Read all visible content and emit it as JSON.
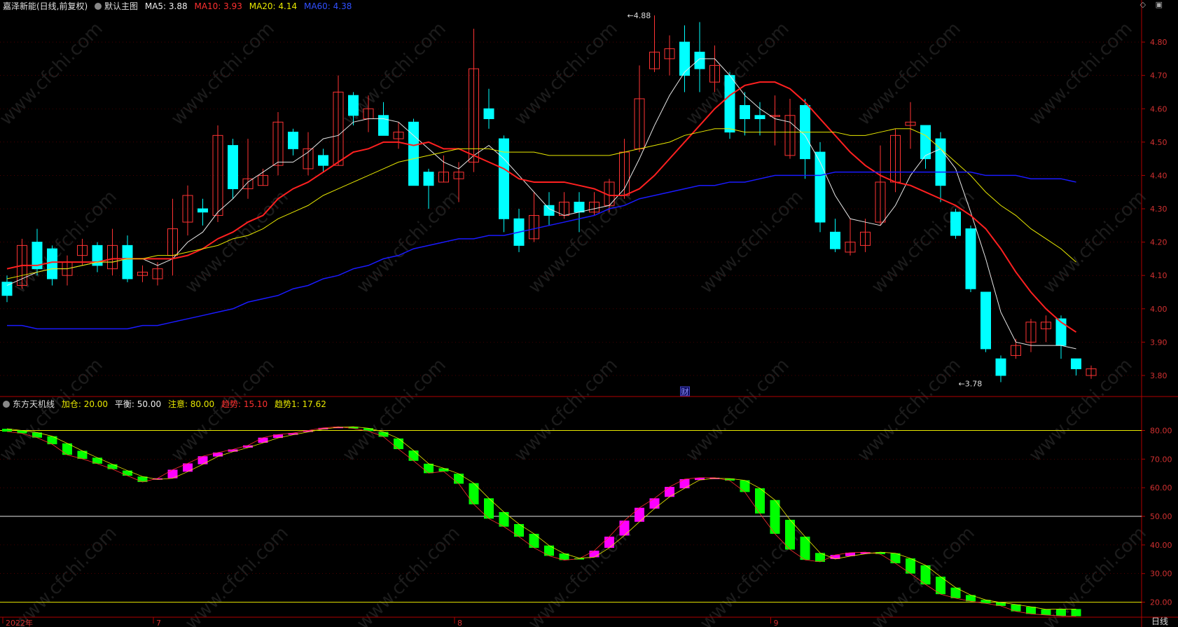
{
  "header": {
    "stock_title": "嘉泽新能(日线,前复权)",
    "main_chart_label": "默认主图",
    "ma5_label": "MA5: 3.88",
    "ma10_label": "MA10: 3.93",
    "ma20_label": "MA20: 4.14",
    "ma60_label": "MA60: 4.38"
  },
  "sub_header": {
    "indicator_name": "东方天机线",
    "jiacang_label": "加仓: 20.00",
    "pingheng_label": "平衡: 50.00",
    "zhuyi_label": "注意: 80.00",
    "qushi_label": "趋势: 15.10",
    "qushi1_label": "趋势1: 17.62"
  },
  "toolbar": {
    "diamond_icon": "diamond-icon",
    "box_icon": "window-icon"
  },
  "footer": {
    "period_label": "日线"
  },
  "colors": {
    "up": "#ff3333",
    "down": "#00ffff",
    "ma5": "#e8e8e8",
    "ma10": "#ff2020",
    "ma20": "#e8e800",
    "ma60": "#1a1aff",
    "sub_up": "#ff00ff",
    "sub_down": "#00ff00",
    "axis": "#b00000",
    "grid": "#7a0000"
  },
  "chart_data": [
    {
      "type": "candlestick",
      "title": "",
      "x_tick_labels": [
        "2022年",
        "7",
        "8",
        "9"
      ],
      "y_tick_labels": [
        "3.80",
        "3.90",
        "4.00",
        "4.10",
        "4.20",
        "4.30",
        "4.40",
        "4.50",
        "4.60",
        "4.70",
        "4.80"
      ],
      "ylim": [
        3.76,
        4.88
      ],
      "annotations": [
        {
          "text": "4.88",
          "value": 4.88,
          "candle_index": 41
        },
        {
          "text": "3.78",
          "value": 3.78,
          "candle_index": 63
        },
        {
          "text": "财",
          "candle_index": 45
        }
      ],
      "candles": [
        [
          4.08,
          4.04,
          4.1,
          4.02
        ],
        [
          4.07,
          4.19,
          4.21,
          4.06
        ],
        [
          4.2,
          4.12,
          4.24,
          4.1
        ],
        [
          4.18,
          4.09,
          4.19,
          4.07
        ],
        [
          4.1,
          4.14,
          4.16,
          4.07
        ],
        [
          4.16,
          4.19,
          4.21,
          4.13
        ],
        [
          4.19,
          4.13,
          4.2,
          4.11
        ],
        [
          4.12,
          4.19,
          4.24,
          4.1
        ],
        [
          4.19,
          4.09,
          4.22,
          4.08
        ],
        [
          4.1,
          4.11,
          4.13,
          4.08
        ],
        [
          4.09,
          4.12,
          4.14,
          4.07
        ],
        [
          4.16,
          4.24,
          4.33,
          4.1
        ],
        [
          4.26,
          4.34,
          4.37,
          4.22
        ],
        [
          4.3,
          4.29,
          4.33,
          4.25
        ],
        [
          4.28,
          4.52,
          4.55,
          4.26
        ],
        [
          4.49,
          4.36,
          4.51,
          4.33
        ],
        [
          4.36,
          4.39,
          4.51,
          4.33
        ],
        [
          4.37,
          4.4,
          4.42,
          4.37
        ],
        [
          4.43,
          4.56,
          4.59,
          4.4
        ],
        [
          4.53,
          4.48,
          4.54,
          4.46
        ],
        [
          4.42,
          4.48,
          4.53,
          4.4
        ],
        [
          4.46,
          4.43,
          4.48,
          4.41
        ],
        [
          4.43,
          4.65,
          4.7,
          4.43
        ],
        [
          4.64,
          4.58,
          4.65,
          4.55
        ],
        [
          4.57,
          4.6,
          4.64,
          4.53
        ],
        [
          4.58,
          4.52,
          4.62,
          4.52
        ],
        [
          4.51,
          4.53,
          4.56,
          4.48
        ],
        [
          4.56,
          4.37,
          4.57,
          4.37
        ],
        [
          4.41,
          4.37,
          4.42,
          4.3
        ],
        [
          4.38,
          4.41,
          4.46,
          4.38
        ],
        [
          4.39,
          4.41,
          4.44,
          4.32
        ],
        [
          4.44,
          4.72,
          4.84,
          4.41
        ],
        [
          4.6,
          4.57,
          4.66,
          4.54
        ],
        [
          4.51,
          4.27,
          4.52,
          4.23
        ],
        [
          4.27,
          4.19,
          4.3,
          4.17
        ],
        [
          4.21,
          4.28,
          4.35,
          4.2
        ],
        [
          4.31,
          4.28,
          4.35,
          4.25
        ],
        [
          4.28,
          4.32,
          4.35,
          4.27
        ],
        [
          4.32,
          4.29,
          4.35,
          4.23
        ],
        [
          4.29,
          4.32,
          4.35,
          4.28
        ],
        [
          4.31,
          4.38,
          4.39,
          4.29
        ],
        [
          4.34,
          4.47,
          4.51,
          4.33
        ],
        [
          4.48,
          4.63,
          4.73,
          4.47
        ],
        [
          4.72,
          4.77,
          4.88,
          4.71
        ],
        [
          4.75,
          4.78,
          4.82,
          4.7
        ],
        [
          4.8,
          4.7,
          4.85,
          4.65
        ],
        [
          4.77,
          4.72,
          4.86,
          4.65
        ],
        [
          4.68,
          4.73,
          4.79,
          4.65
        ],
        [
          4.7,
          4.53,
          4.71,
          4.51
        ],
        [
          4.61,
          4.57,
          4.65,
          4.52
        ],
        [
          4.58,
          4.57,
          4.62,
          4.52
        ],
        [
          4.58,
          4.58,
          4.64,
          4.49
        ],
        [
          4.46,
          4.58,
          4.63,
          4.45
        ],
        [
          4.61,
          4.45,
          4.63,
          4.39
        ],
        [
          4.47,
          4.26,
          4.5,
          4.23
        ],
        [
          4.23,
          4.18,
          4.27,
          4.17
        ],
        [
          4.17,
          4.2,
          4.27,
          4.16
        ],
        [
          4.19,
          4.23,
          4.27,
          4.17
        ],
        [
          4.26,
          4.38,
          4.49,
          4.25
        ],
        [
          4.38,
          4.52,
          4.54,
          4.35
        ],
        [
          4.55,
          4.56,
          4.62,
          4.48
        ],
        [
          4.55,
          4.45,
          4.55,
          4.42
        ],
        [
          4.51,
          4.37,
          4.53,
          4.32
        ],
        [
          4.29,
          4.22,
          4.3,
          4.21
        ],
        [
          4.24,
          4.06,
          4.25,
          4.05
        ],
        [
          4.05,
          3.88,
          4.05,
          3.87
        ],
        [
          3.85,
          3.8,
          3.86,
          3.78
        ],
        [
          3.86,
          3.89,
          3.91,
          3.85
        ],
        [
          3.9,
          3.96,
          3.97,
          3.87
        ],
        [
          3.94,
          3.96,
          3.98,
          3.9
        ],
        [
          3.97,
          3.89,
          3.98,
          3.85
        ],
        [
          3.85,
          3.82,
          3.85,
          3.8
        ],
        [
          3.8,
          3.82,
          3.83,
          3.79
        ]
      ],
      "series": [
        {
          "name": "MA5",
          "values": [
            4.07,
            4.09,
            4.11,
            4.12,
            4.12,
            4.13,
            4.14,
            4.14,
            4.15,
            4.15,
            4.13,
            4.15,
            4.2,
            4.23,
            4.29,
            4.33,
            4.38,
            4.41,
            4.44,
            4.44,
            4.47,
            4.51,
            4.52,
            4.56,
            4.57,
            4.57,
            4.56,
            4.52,
            4.48,
            4.44,
            4.42,
            4.46,
            4.49,
            4.45,
            4.4,
            4.35,
            4.3,
            4.28,
            4.29,
            4.3,
            4.31,
            4.36,
            4.45,
            4.55,
            4.64,
            4.71,
            4.75,
            4.75,
            4.7,
            4.64,
            4.6,
            4.57,
            4.56,
            4.52,
            4.44,
            4.34,
            4.27,
            4.26,
            4.25,
            4.31,
            4.4,
            4.46,
            4.48,
            4.42,
            4.29,
            4.15,
            3.99,
            3.9,
            3.89,
            3.89,
            3.89,
            3.88
          ]
        },
        {
          "name": "MA10",
          "values": [
            4.12,
            4.13,
            4.13,
            4.14,
            4.14,
            4.14,
            4.14,
            4.15,
            4.15,
            4.15,
            4.15,
            4.15,
            4.16,
            4.18,
            4.21,
            4.23,
            4.26,
            4.28,
            4.33,
            4.36,
            4.38,
            4.41,
            4.44,
            4.47,
            4.48,
            4.5,
            4.5,
            4.49,
            4.5,
            4.48,
            4.48,
            4.46,
            4.44,
            4.42,
            4.39,
            4.38,
            4.38,
            4.38,
            4.37,
            4.36,
            4.34,
            4.34,
            4.36,
            4.4,
            4.45,
            4.5,
            4.55,
            4.6,
            4.64,
            4.67,
            4.68,
            4.68,
            4.66,
            4.62,
            4.57,
            4.52,
            4.47,
            4.43,
            4.4,
            4.38,
            4.37,
            4.35,
            4.33,
            4.31,
            4.28,
            4.24,
            4.18,
            4.11,
            4.05,
            4.0,
            3.96,
            3.93
          ]
        },
        {
          "name": "MA20",
          "values": [
            4.09,
            4.1,
            4.11,
            4.12,
            4.12,
            4.13,
            4.14,
            4.14,
            4.15,
            4.15,
            4.16,
            4.16,
            4.17,
            4.18,
            4.19,
            4.21,
            4.22,
            4.24,
            4.27,
            4.29,
            4.31,
            4.34,
            4.36,
            4.38,
            4.4,
            4.42,
            4.44,
            4.45,
            4.46,
            4.47,
            4.48,
            4.48,
            4.48,
            4.47,
            4.47,
            4.47,
            4.46,
            4.46,
            4.46,
            4.46,
            4.46,
            4.47,
            4.48,
            4.49,
            4.5,
            4.52,
            4.53,
            4.54,
            4.54,
            4.53,
            4.53,
            4.53,
            4.53,
            4.53,
            4.53,
            4.53,
            4.52,
            4.52,
            4.53,
            4.54,
            4.54,
            4.52,
            4.48,
            4.44,
            4.4,
            4.35,
            4.31,
            4.28,
            4.24,
            4.21,
            4.18,
            4.14
          ]
        },
        {
          "name": "MA60",
          "values": [
            3.95,
            3.95,
            3.94,
            3.94,
            3.94,
            3.94,
            3.94,
            3.94,
            3.94,
            3.95,
            3.95,
            3.96,
            3.97,
            3.98,
            3.99,
            4.0,
            4.02,
            4.03,
            4.04,
            4.06,
            4.07,
            4.09,
            4.1,
            4.12,
            4.13,
            4.15,
            4.16,
            4.18,
            4.19,
            4.2,
            4.21,
            4.21,
            4.22,
            4.22,
            4.23,
            4.24,
            4.25,
            4.26,
            4.27,
            4.28,
            4.3,
            4.31,
            4.33,
            4.34,
            4.35,
            4.36,
            4.37,
            4.37,
            4.38,
            4.38,
            4.39,
            4.4,
            4.4,
            4.4,
            4.4,
            4.41,
            4.41,
            4.41,
            4.41,
            4.41,
            4.41,
            4.41,
            4.41,
            4.41,
            4.41,
            4.4,
            4.4,
            4.4,
            4.39,
            4.39,
            4.39,
            4.38
          ]
        }
      ]
    },
    {
      "type": "indicator",
      "title": "东方天机线",
      "y_tick_labels": [
        "20.00",
        "30.00",
        "40.00",
        "50.00",
        "60.00",
        "70.00",
        "80.00"
      ],
      "ylim": [
        15,
        86
      ],
      "reference_lines": [
        {
          "name": "加仓",
          "value": 20
        },
        {
          "name": "平衡",
          "value": 50
        },
        {
          "name": "注意",
          "value": 80
        }
      ],
      "series": [
        {
          "name": "趋势",
          "values": [
            79.6,
            79.0,
            77.5,
            75.2,
            71.5,
            70.1,
            68.4,
            66.5,
            64.2,
            62.0,
            63.3,
            66.3,
            68.5,
            71.0,
            72.3,
            73.4,
            74.8,
            77.5,
            78.6,
            79.1,
            80.0,
            80.9,
            81.3,
            80.7,
            79.8,
            77.8,
            73.5,
            69.4,
            65.1,
            65.7,
            61.4,
            54.2,
            49.2,
            46.4,
            42.9,
            39.0,
            36.2,
            34.7,
            35.2,
            38.0,
            42.9,
            48.5,
            53.0,
            56.3,
            60.3,
            63.0,
            63.5,
            63.5,
            62.5,
            58.5,
            51.0,
            43.9,
            38.4,
            34.8,
            34.1,
            36.5,
            37.3,
            37.5,
            36.8,
            33.6,
            30.0,
            26.2,
            22.8,
            21.4,
            20.3,
            19.6,
            18.7,
            16.8,
            15.9,
            15.5,
            15.2,
            15.1
          ]
        },
        {
          "name": "趋势1",
          "values": [
            80.6,
            80.0,
            79.3,
            78.0,
            75.5,
            72.9,
            70.5,
            68.2,
            66.0,
            63.9,
            62.9,
            63.3,
            65.6,
            68.2,
            70.9,
            72.6,
            74.0,
            75.7,
            77.4,
            78.5,
            79.5,
            80.5,
            81.1,
            81.3,
            80.8,
            79.5,
            77.2,
            73.0,
            68.4,
            66.8,
            64.9,
            61.6,
            56.3,
            51.5,
            47.3,
            43.9,
            39.8,
            37.0,
            35.4,
            35.7,
            39.0,
            43.3,
            48.1,
            52.7,
            56.8,
            59.8,
            62.7,
            63.3,
            63.2,
            62.6,
            59.8,
            55.7,
            48.8,
            42.9,
            37.2,
            35.1,
            36.1,
            36.9,
            37.5,
            37.1,
            35.3,
            32.9,
            28.9,
            25.1,
            22.5,
            20.8,
            19.9,
            19.2,
            18.4,
            17.5,
            17.6,
            17.6
          ]
        }
      ]
    }
  ]
}
